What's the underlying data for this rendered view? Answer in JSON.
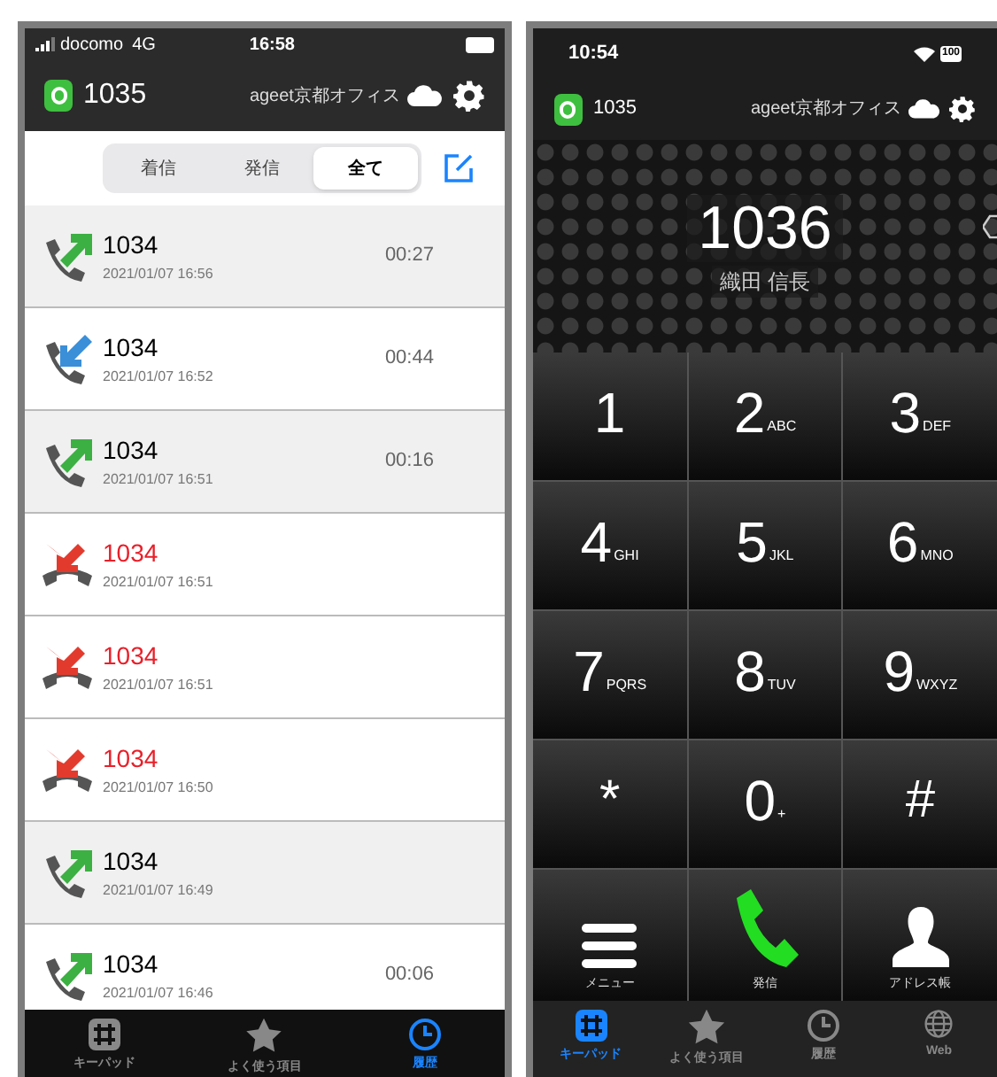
{
  "history_screen": {
    "status_bar": {
      "carrier": "docomo",
      "network": "4G",
      "time": "16:58"
    },
    "header": {
      "extension": "1035",
      "office": "ageet京都オフィス"
    },
    "filter_tabs": [
      {
        "label": "着信",
        "selected": false
      },
      {
        "label": "発信",
        "selected": false
      },
      {
        "label": "全て",
        "selected": true
      }
    ],
    "calls": [
      {
        "kind": "outgoing",
        "number": "1034",
        "datetime": "2021/01/07 16:56",
        "duration": "00:27",
        "shaded": true
      },
      {
        "kind": "incoming",
        "number": "1034",
        "datetime": "2021/01/07 16:52",
        "duration": "00:44",
        "shaded": false
      },
      {
        "kind": "outgoing",
        "number": "1034",
        "datetime": "2021/01/07 16:51",
        "duration": "00:16",
        "shaded": true
      },
      {
        "kind": "missed",
        "number": "1034",
        "datetime": "2021/01/07 16:51",
        "shaded": false
      },
      {
        "kind": "missed",
        "number": "1034",
        "datetime": "2021/01/07 16:51",
        "shaded": false
      },
      {
        "kind": "missed",
        "number": "1034",
        "datetime": "2021/01/07 16:50",
        "shaded": false
      },
      {
        "kind": "outgoing",
        "number": "1034",
        "datetime": "2021/01/07 16:49",
        "shaded": true
      },
      {
        "kind": "outgoing",
        "number": "1034",
        "datetime": "2021/01/07 16:46",
        "duration": "00:06",
        "shaded": false
      }
    ],
    "tab_bar": [
      {
        "kind": "keypad",
        "label": "キーパッド",
        "selected": false
      },
      {
        "kind": "favorites",
        "label": "よく使う項目",
        "selected": false
      },
      {
        "kind": "history",
        "label": "履歴",
        "selected": true
      }
    ]
  },
  "dialer_screen": {
    "status_bar": {
      "time": "10:54",
      "battery": "100"
    },
    "header": {
      "extension": "1035",
      "office": "ageet京都オフィス"
    },
    "display": {
      "number": "1036",
      "name": "織田 信長"
    },
    "keys": [
      {
        "digit": "1"
      },
      {
        "digit": "2",
        "letters": "ABC"
      },
      {
        "digit": "3",
        "letters": "DEF"
      },
      {
        "digit": "4",
        "letters": "GHI"
      },
      {
        "digit": "5",
        "letters": "JKL"
      },
      {
        "digit": "6",
        "letters": "MNO"
      },
      {
        "digit": "7",
        "letters": "PQRS"
      },
      {
        "digit": "8",
        "letters": "TUV"
      },
      {
        "digit": "9",
        "letters": "WXYZ"
      },
      {
        "digit": "*"
      },
      {
        "digit": "0",
        "letters": "+"
      },
      {
        "digit": "#"
      }
    ],
    "actions": [
      {
        "kind": "menu",
        "label": "メニュー"
      },
      {
        "kind": "call",
        "label": "発信"
      },
      {
        "kind": "contacts",
        "label": "アドレス帳"
      }
    ],
    "tab_bar": [
      {
        "kind": "keypad",
        "label": "キーパッド",
        "selected": true
      },
      {
        "kind": "favorites",
        "label": "よく使う項目",
        "selected": false
      },
      {
        "kind": "history",
        "label": "履歴",
        "selected": false
      },
      {
        "kind": "web",
        "label": "Web",
        "selected": false
      }
    ]
  }
}
